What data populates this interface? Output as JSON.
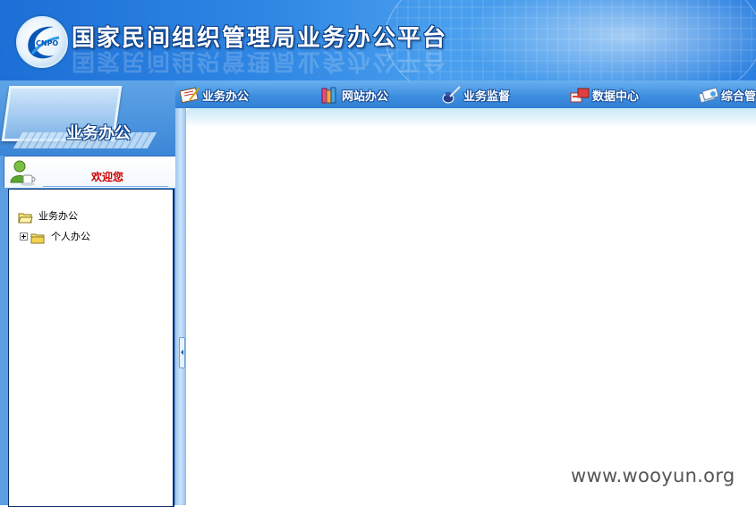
{
  "header": {
    "title": "国家民间组织管理局业务办公平台",
    "logo_text": "CNPO"
  },
  "left_panel": {
    "title": "业务办公"
  },
  "nav": {
    "items": [
      {
        "label": "业务办公",
        "icon": "notepad-pen-icon"
      },
      {
        "label": "网站办公",
        "icon": "books-icon"
      },
      {
        "label": "业务监督",
        "icon": "inkwell-pen-icon"
      },
      {
        "label": "数据中心",
        "icon": "data-boxes-icon"
      },
      {
        "label": "综合管",
        "icon": "documents-icon"
      }
    ]
  },
  "welcome": {
    "text": "欢迎您",
    "icon": "user-coffee-icon"
  },
  "tree": {
    "root": {
      "label": "业务办公",
      "icon": "folder-open-icon"
    },
    "children": [
      {
        "label": "个人办公",
        "icon": "folder-icon",
        "expanded": false
      }
    ]
  },
  "watermark": "www.wooyun.org",
  "colors": {
    "header_blue": "#2f86e3",
    "nav_blue": "#3e8fe0",
    "welcome_red": "#cc0000"
  }
}
